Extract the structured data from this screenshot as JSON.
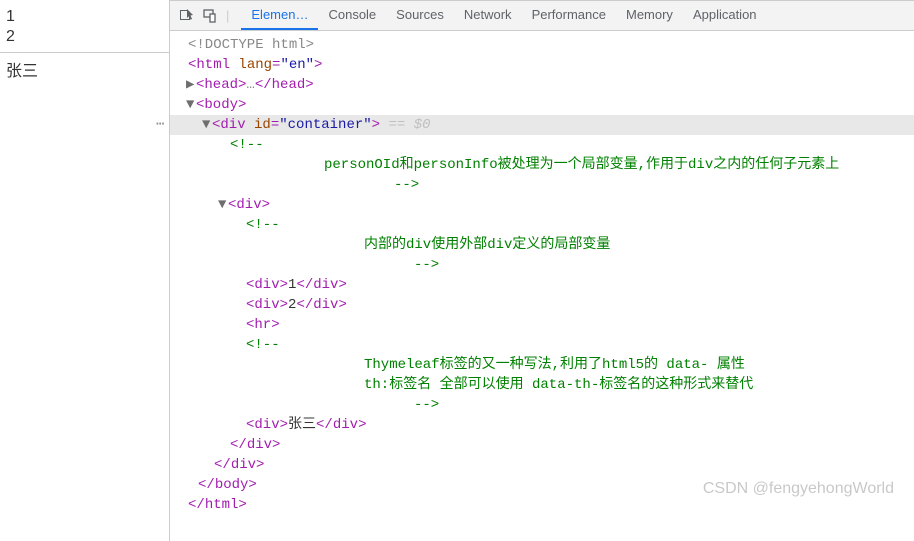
{
  "page": {
    "lines": [
      "1",
      "2"
    ],
    "name": "张三"
  },
  "toolbar": {
    "tabs": [
      "Elemen…",
      "Console",
      "Sources",
      "Network",
      "Performance",
      "Memory",
      "Application"
    ],
    "active_index": 0
  },
  "dom": {
    "doctype": "<!DOCTYPE html>",
    "html_open": "html",
    "html_lang_attr": "lang",
    "html_lang_val": "\"en\"",
    "head_open": "head",
    "head_ellipsis": "…",
    "head_close": "head",
    "body_open": "body",
    "container_tag": "div",
    "container_id_attr": "id",
    "container_id_val": "\"container\"",
    "eq0": " == $0",
    "comment_open": "<!--",
    "comment_close": "-->",
    "comment1": "personOId和personInfo被处理为一个局部变量,作用于div之内的任何子元素上",
    "inner_div": "div",
    "comment2": "内部的div使用外部div定义的局部变量",
    "div1_val": "1",
    "div2_val": "2",
    "hr_tag": "hr",
    "comment3a": "Thymeleaf标签的又一种写法,利用了html5的 data- 属性",
    "comment3b": "th:标签名 全部可以使用 data-th-标签名的这种形式来替代",
    "name_val": "张三"
  },
  "watermark": "CSDN @fengyehongWorld"
}
